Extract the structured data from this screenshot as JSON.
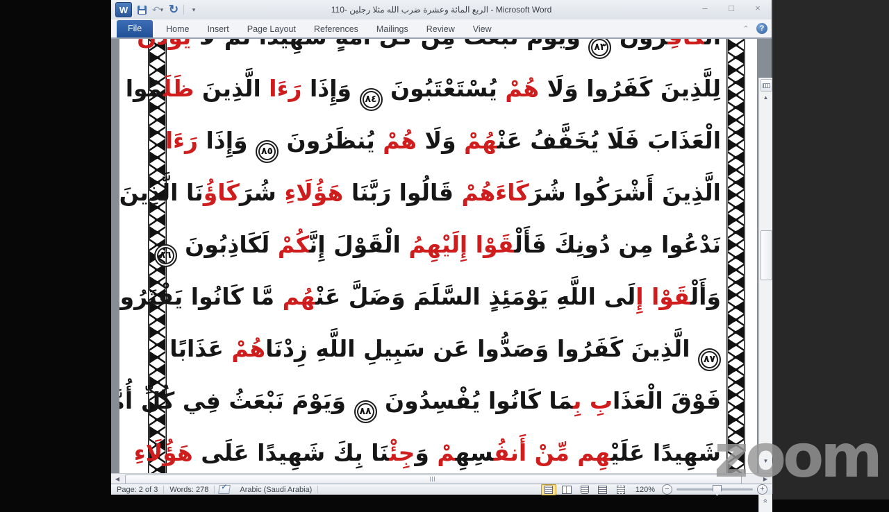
{
  "window": {
    "title": "الربع المائة وعشرة ضرب الله مثلا رجلين -110 - Microsoft Word",
    "controls": {
      "minimize": "–",
      "maximize": "□",
      "close": "×"
    }
  },
  "qat": {
    "items": [
      "word-logo",
      "save",
      "undo",
      "redo",
      "customize-quick-access"
    ]
  },
  "ribbon": {
    "tabs": [
      {
        "label": "File",
        "active": true
      },
      {
        "label": "Home",
        "active": false
      },
      {
        "label": "Insert",
        "active": false
      },
      {
        "label": "Page Layout",
        "active": false
      },
      {
        "label": "References",
        "active": false
      },
      {
        "label": "Mailings",
        "active": false
      },
      {
        "label": "Review",
        "active": false
      },
      {
        "label": "View",
        "active": false
      }
    ],
    "help_label": "?"
  },
  "document": {
    "lines": [
      [
        {
          "t": "الْ"
        },
        {
          "t": "كَافِ",
          "c": "r"
        },
        {
          "t": "رُونَ "
        },
        {
          "aya": "٨٣"
        },
        {
          "t": " وَيَوْمَ نَبْعَثُ مِن كُلِّ أُمَّةٍ شَهِيدًا ثُمَّ لَا "
        },
        {
          "t": "يُؤْذَنُ",
          "c": "r"
        }
      ],
      [
        {
          "t": "لِلَّذِينَ كَفَرُوا وَلَا "
        },
        {
          "t": "هُمْ",
          "c": "r"
        },
        {
          "t": " يُسْتَعْتَبُونَ "
        },
        {
          "aya": "٨٤"
        },
        {
          "t": " وَإِذَا "
        },
        {
          "t": "رَءَا",
          "c": "r"
        },
        {
          "t": " الَّذِينَ "
        },
        {
          "t": "ظَلَ",
          "c": "r"
        },
        {
          "t": "مُوا"
        }
      ],
      [
        {
          "t": "الْعَذَابَ فَلَا يُخَفَّفُ عَنْ"
        },
        {
          "t": "هُمْ",
          "c": "r"
        },
        {
          "t": " وَلَا "
        },
        {
          "t": "هُمْ",
          "c": "r"
        },
        {
          "t": " يُنظَرُونَ "
        },
        {
          "aya": "٨٥"
        },
        {
          "t": " وَإِذَا "
        },
        {
          "t": "رَءَا",
          "c": "r"
        }
      ],
      [
        {
          "t": "الَّذِينَ أَشْرَكُوا شُرَ"
        },
        {
          "t": "كَاءَهُمْ",
          "c": "r"
        },
        {
          "t": " قَالُوا رَبَّنَا "
        },
        {
          "t": "هَؤُلَاءِ",
          "c": "r"
        },
        {
          "t": " شُرَ"
        },
        {
          "t": "كَاؤُ",
          "c": "r"
        },
        {
          "t": "نَا الَّذِينَ كُنَّا"
        }
      ],
      [
        {
          "t": "نَدْعُوا مِن دُونِكَ فَأَلْ"
        },
        {
          "t": "قَوْا إِلَيْهِمُ",
          "c": "r"
        },
        {
          "t": " الْقَوْلَ إِنَّ"
        },
        {
          "t": "كُمْ",
          "c": "r"
        },
        {
          "t": " لَكَاذِبُونَ "
        },
        {
          "aya": "٨٦"
        }
      ],
      [
        {
          "t": "وَأَلْ"
        },
        {
          "t": "قَوْا إِ",
          "c": "r"
        },
        {
          "t": "لَى اللَّهِ يَوْمَئِذٍ السَّلَمَ وَضَلَّ عَنْ"
        },
        {
          "t": "هُم",
          "c": "r"
        },
        {
          "t": " مَّا كَانُوا يَفْتَرُونَ"
        }
      ],
      [
        {
          "aya": "٨٧"
        },
        {
          "t": " الَّذِينَ كَفَرُوا وَصَدُّوا عَن سَبِيلِ اللَّهِ زِدْنَا"
        },
        {
          "t": "هُمْ",
          "c": "r"
        },
        {
          "t": " عَذَابًا"
        }
      ],
      [
        {
          "t": "فَوْقَ الْعَذَا"
        },
        {
          "t": "بِ بِ",
          "c": "r"
        },
        {
          "t": "مَا كَانُوا يُفْسِدُونَ "
        },
        {
          "aya": "٨٨"
        },
        {
          "t": " وَيَوْمَ نَبْعَثُ فِي كُلِّ أُمَّةٍ"
        }
      ],
      [
        {
          "t": "شَهِيدًا عَلَيْ"
        },
        {
          "t": "هِم",
          "c": "r"
        },
        {
          "t": " "
        },
        {
          "t": "مِّنْ أَنفُ",
          "c": "r"
        },
        {
          "t": "سِهِ"
        },
        {
          "t": "مْ",
          "c": "r"
        },
        {
          "t": " وَ"
        },
        {
          "t": "جِئْ",
          "c": "r"
        },
        {
          "t": "نَا بِكَ شَهِيدًا عَلَى "
        },
        {
          "t": "هَؤُلَاءِ",
          "c": "r"
        }
      ]
    ],
    "text_colors": {
      "black": "#161616",
      "red": "#cf1c1c"
    }
  },
  "status": {
    "page": "Page: 2 of 3",
    "words": "Words: 278",
    "language": "Arabic (Saudi Arabia)",
    "zoom_level": "120%",
    "view_buttons": [
      "print-layout",
      "full-screen-reading",
      "web-layout",
      "outline",
      "draft"
    ],
    "active_view": "print-layout"
  },
  "watermark": {
    "text": "zoom"
  },
  "colors": {
    "file_tab_blue": "#2b5aa0",
    "status_active_highlight": "#fbe296",
    "page_bg": "#ffffff"
  }
}
